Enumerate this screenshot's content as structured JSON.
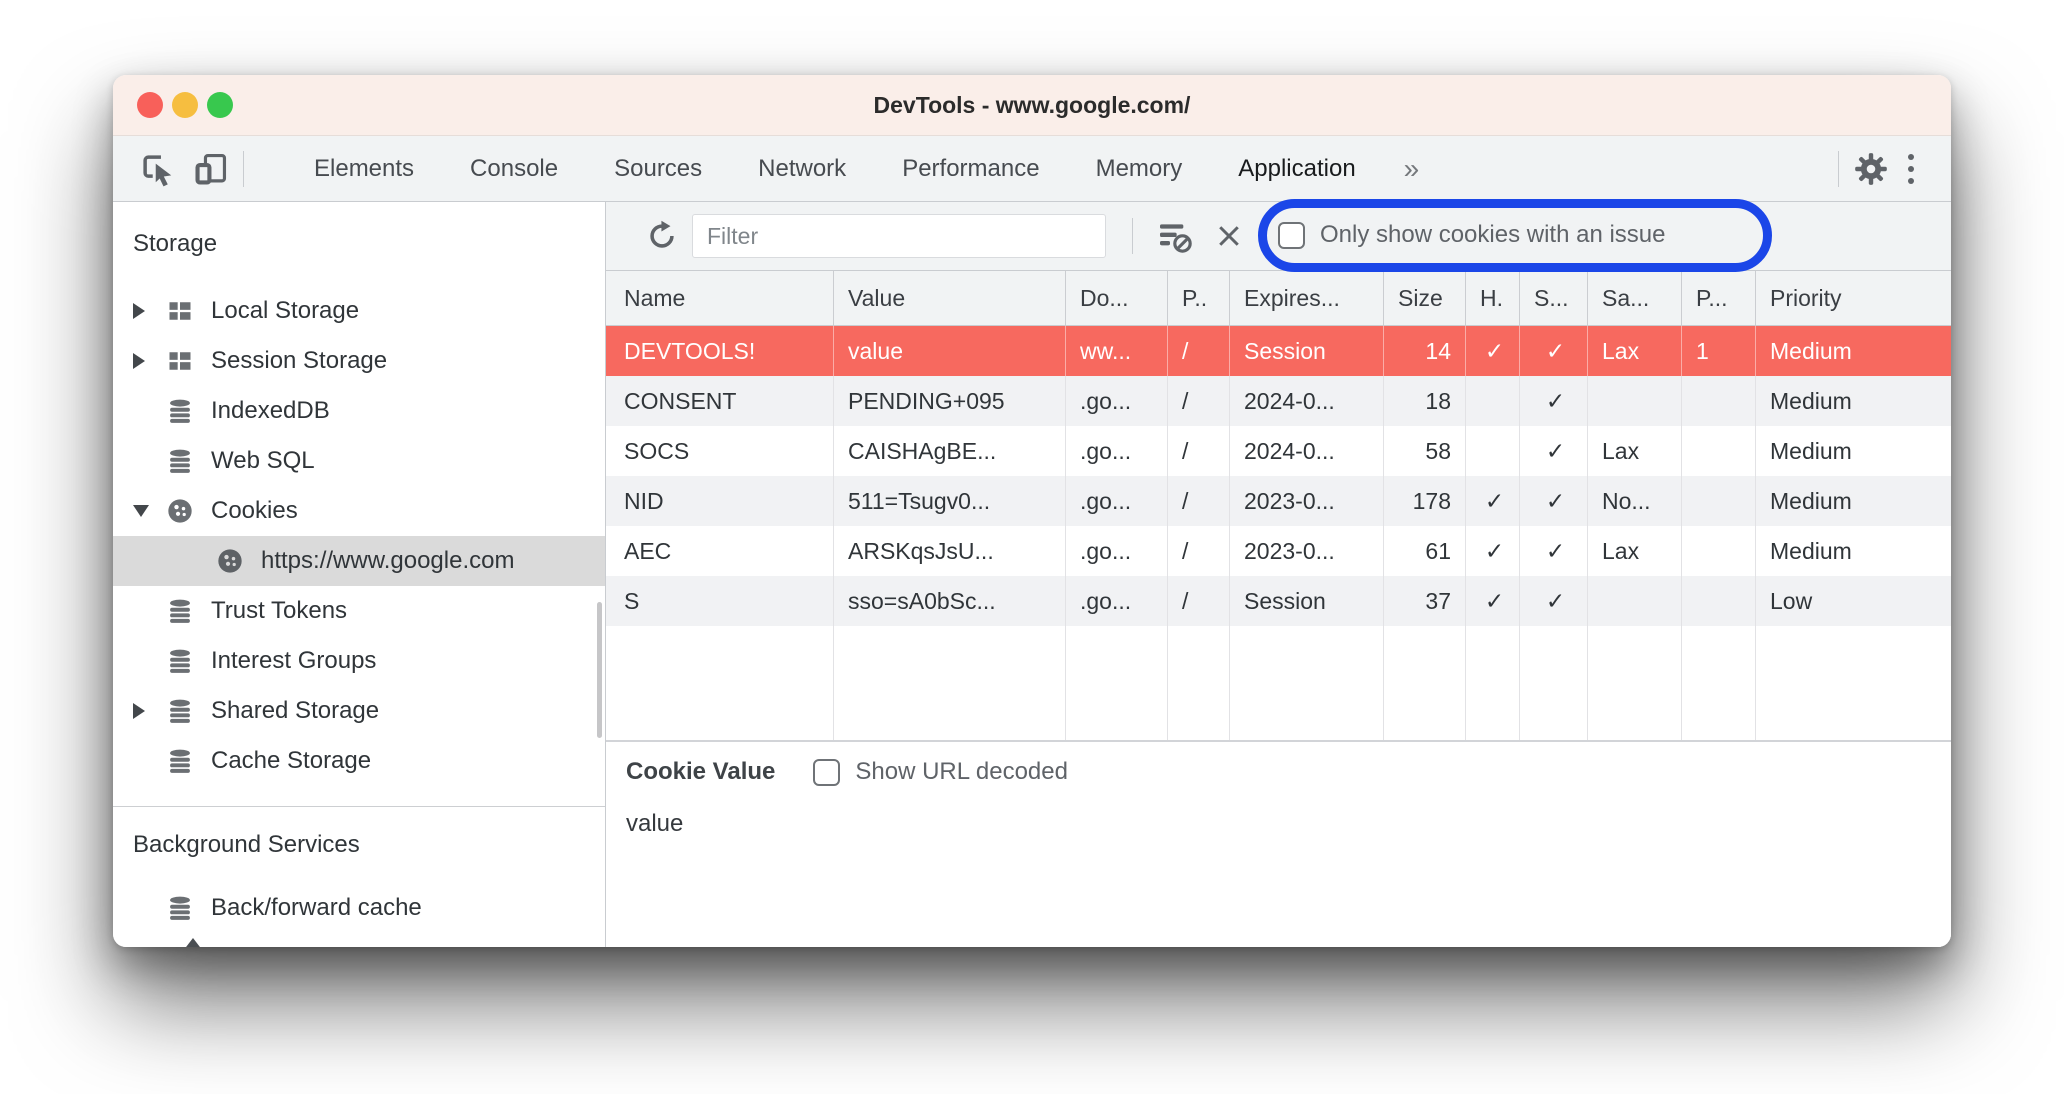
{
  "titlebar": {
    "title": "DevTools - www.google.com/"
  },
  "tabbar": {
    "tabs": [
      {
        "label": "Elements"
      },
      {
        "label": "Console"
      },
      {
        "label": "Sources"
      },
      {
        "label": "Network"
      },
      {
        "label": "Performance"
      },
      {
        "label": "Memory"
      },
      {
        "label": "Application"
      }
    ],
    "active_tab": "Application",
    "more_tabs": "»"
  },
  "sidebar": {
    "storage_header": "Storage",
    "items": [
      {
        "label": "Local Storage",
        "icon": "table-icon",
        "arrow": "collapsed"
      },
      {
        "label": "Session Storage",
        "icon": "table-icon",
        "arrow": "collapsed"
      },
      {
        "label": "IndexedDB",
        "icon": "database-icon",
        "arrow": "none"
      },
      {
        "label": "Web SQL",
        "icon": "database-icon",
        "arrow": "none"
      },
      {
        "label": "Cookies",
        "icon": "cookie-icon",
        "arrow": "expanded"
      },
      {
        "label": "https://www.google.com",
        "icon": "cookie-icon",
        "arrow": "none",
        "selected": true
      },
      {
        "label": "Trust Tokens",
        "icon": "database-icon",
        "arrow": "none"
      },
      {
        "label": "Interest Groups",
        "icon": "database-icon",
        "arrow": "none"
      },
      {
        "label": "Shared Storage",
        "icon": "database-icon",
        "arrow": "collapsed"
      },
      {
        "label": "Cache Storage",
        "icon": "database-icon",
        "arrow": "none"
      }
    ],
    "background_header": "Background Services",
    "background_items": [
      {
        "label": "Back/forward cache",
        "icon": "database-icon",
        "arrow": "none"
      }
    ]
  },
  "toolbar": {
    "filter_placeholder": "Filter",
    "checkbox_label": "Only show cookies with an issue",
    "checkbox_checked": false,
    "highlight_color": "#1B46E8"
  },
  "table": {
    "columns": [
      "Name",
      "Value",
      "Do...",
      "P..",
      "Expires...",
      "Size",
      "H.",
      "S...",
      "Sa...",
      "P...",
      "Priority"
    ],
    "rows": [
      {
        "selected": true,
        "cells": [
          "DEVTOOLS!",
          "value",
          "ww...",
          "/",
          "Session",
          "14",
          "✓",
          "✓",
          "Lax",
          "1",
          "Medium"
        ]
      },
      {
        "selected": false,
        "cells": [
          "CONSENT",
          "PENDING+095",
          ".go...",
          "/",
          "2024-0...",
          "18",
          "",
          "✓",
          "",
          "",
          "Medium"
        ]
      },
      {
        "selected": false,
        "cells": [
          "SOCS",
          "CAISHAgBE...",
          ".go...",
          "/",
          "2024-0...",
          "58",
          "",
          "✓",
          "Lax",
          "",
          "Medium"
        ]
      },
      {
        "selected": false,
        "cells": [
          "NID",
          "511=Tsugv0...",
          ".go...",
          "/",
          "2023-0...",
          "178",
          "✓",
          "✓",
          "No...",
          "",
          "Medium"
        ]
      },
      {
        "selected": false,
        "cells": [
          "AEC",
          "ARSKqsJsU...",
          ".go...",
          "/",
          "2023-0...",
          "61",
          "✓",
          "✓",
          "Lax",
          "",
          "Medium"
        ]
      },
      {
        "selected": false,
        "cells": [
          "S",
          "sso=sA0bSc...",
          ".go...",
          "/",
          "Session",
          "37",
          "✓",
          "✓",
          "",
          "",
          "Low"
        ]
      }
    ],
    "selected_row_color": "#F7695F"
  },
  "preview": {
    "title": "Cookie Value",
    "decode_label": "Show URL decoded",
    "decode_checked": false,
    "value": "value"
  },
  "colors": {
    "titlebar_bg": "#FAEEE9",
    "chrome_bg": "#F1F3F4",
    "selected_sidebar_bg": "#DADADA",
    "highlight_blue": "#1B46E8",
    "selected_row_red": "#F7695F"
  }
}
